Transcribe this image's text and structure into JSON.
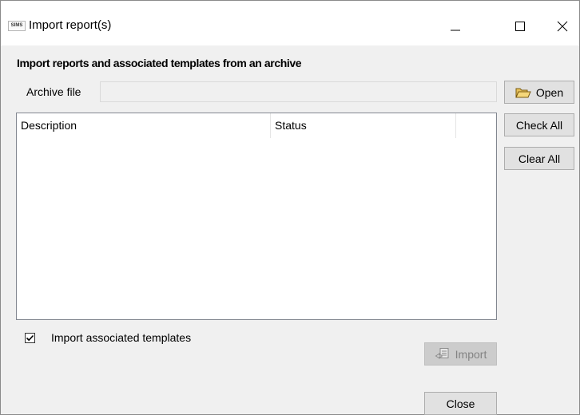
{
  "window": {
    "title": "Import report(s)",
    "app_icon_text": "SIMS"
  },
  "section": {
    "title": "Import reports and associated templates from an archive"
  },
  "archive": {
    "label": "Archive file",
    "value": ""
  },
  "buttons": {
    "open": "Open",
    "check_all": "Check All",
    "clear_all": "Clear All",
    "import": "Import",
    "close": "Close"
  },
  "list": {
    "columns": [
      "Description",
      "Status"
    ],
    "rows": []
  },
  "options": {
    "import_templates_label": "Import associated templates",
    "import_templates_checked": true
  },
  "colors": {
    "window_bg": "#f0f0f0",
    "button_bg": "#e1e1e1",
    "disabled_text": "#838383"
  }
}
